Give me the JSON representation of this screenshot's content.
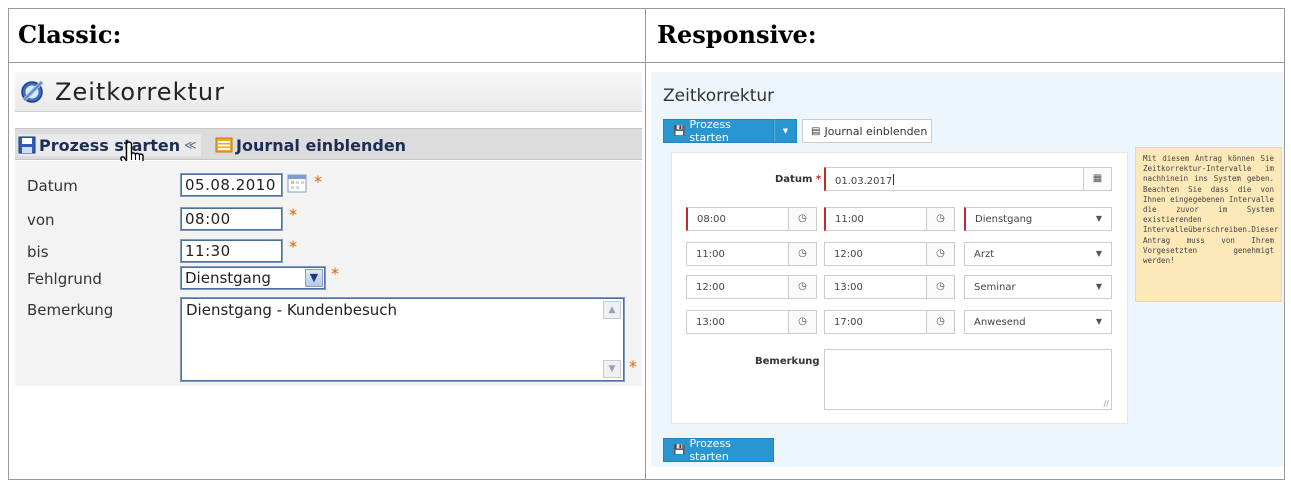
{
  "headers": {
    "classic": "Classic:",
    "responsive": "Responsive:"
  },
  "classic": {
    "title": "Zeitkorrektur",
    "toolbar": {
      "start_label": "Prozess starten",
      "journal_label": "Journal einblenden"
    },
    "form": {
      "datum_label": "Datum",
      "datum_value": "05.08.2010",
      "von_label": "von",
      "von_value": "08:00",
      "bis_label": "bis",
      "bis_value": "11:30",
      "fehlgrund_label": "Fehlgrund",
      "fehlgrund_value": "Dienstgang",
      "bemerkung_label": "Bemerkung",
      "bemerkung_value": "Dienstgang - Kundenbesuch",
      "required_mark": "*"
    }
  },
  "responsive": {
    "title": "Zeitkorrektur",
    "start_label": "Prozess starten",
    "journal_label": "Journal einblenden",
    "datum_label": "Datum",
    "required_mark": "*",
    "datum_value": "01.03.2017",
    "rows": [
      {
        "from": "08:00",
        "to": "11:00",
        "reason": "Dienstgang"
      },
      {
        "from": "11:00",
        "to": "12:00",
        "reason": "Arzt"
      },
      {
        "from": "12:00",
        "to": "13:00",
        "reason": "Seminar"
      },
      {
        "from": "13:00",
        "to": "17:00",
        "reason": "Anwesend"
      }
    ],
    "bemerkung_label": "Bemerkung",
    "bottom_start_label": "Prozess starten",
    "note": "Mit diesem Antrag können Sie Zeitkorrektur-Intervalle im nachhinein ins System geben. Beachten Sie dass die von Ihnen eingegebenen Intervalle die zuvor im System existierenden Intervalleüberschreiben.Dieser Antrag muss von Ihrem Vorgesetzten genehmigt werden!"
  },
  "colors": {
    "primary_button": "#2a96d1",
    "required": "#c0292d",
    "classic_required": "#e06000",
    "note_bg": "#fde8b8",
    "panel_bg": "#eef6fd"
  },
  "icons": [
    "classic-title-icon",
    "save-icon",
    "double-chevron-icon",
    "journal-icon",
    "hand-cursor-icon",
    "calendar-icon",
    "dropdown-arrow-icon",
    "scroll-up-icon",
    "scroll-down-icon",
    "clock-icon",
    "caret-down-icon",
    "resize-grip-icon"
  ]
}
